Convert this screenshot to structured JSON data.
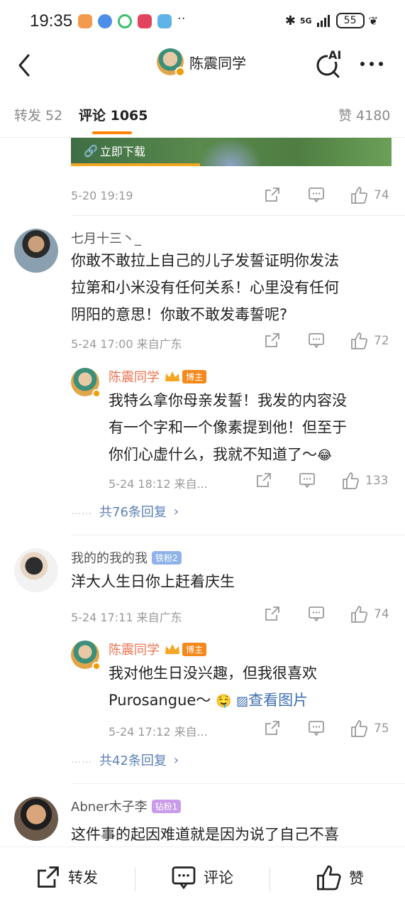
{
  "status_bar": {
    "time": "19:35",
    "battery": "55",
    "network": "5G"
  },
  "header": {
    "title": "陈震同学",
    "ai_label": "AI"
  },
  "tabs": {
    "repost": "转发 52",
    "comments": "评论 1065",
    "likes": "赞 4180"
  },
  "preview": {
    "download": "立即下载",
    "date": "5-20 19:19",
    "like_count": "74"
  },
  "comments": [
    {
      "username": "七月十三丶_",
      "text_lines": [
        "你敢不敢拉上自己的儿子发誓证明你发法",
        "拉第和小米没有任何关系！心里没有任何",
        "阴阳的意思！你敢不敢发毒誓呢?"
      ],
      "meta": "5-24 17:00  来自广东",
      "like_count": "72",
      "reply": {
        "username": "陈震同学",
        "badge": "博主",
        "text_lines": [
          "我特么拿你母亲发誓！我发的内容没",
          "有一个字和一个像素提到他！但至于",
          "你们心虚什么，我就不知道了～"
        ],
        "meta": "5-24 18:12  来自...",
        "like_count": "133"
      },
      "more_replies": "共76条回复"
    },
    {
      "username": "我的的我的我",
      "fan_badge": "铁粉2",
      "text_lines": [
        "洋大人生日你上赶着庆生"
      ],
      "meta": "5-24 17:11  来自广东",
      "like_count": "74",
      "reply": {
        "username": "陈震同学",
        "badge": "博主",
        "text_lines": [
          "我对他生日没兴趣，但我很喜欢",
          "Purosangue～"
        ],
        "image_link": "查看图片",
        "meta": "5-24 17:12  来自...",
        "like_count": "75"
      },
      "more_replies": "共42条回复"
    },
    {
      "username": "Abner木子李",
      "fan_badge": "钻粉1",
      "text_lines": [
        "这件事的起因难道就是因为说了自己不喜"
      ]
    }
  ],
  "bottom_bar": {
    "repost": "转发",
    "comment": "评论",
    "like": "赞"
  },
  "colors": {
    "accent": "#ff8200",
    "username_orange": "#eb7350",
    "link_blue": "#5b7fb5"
  }
}
